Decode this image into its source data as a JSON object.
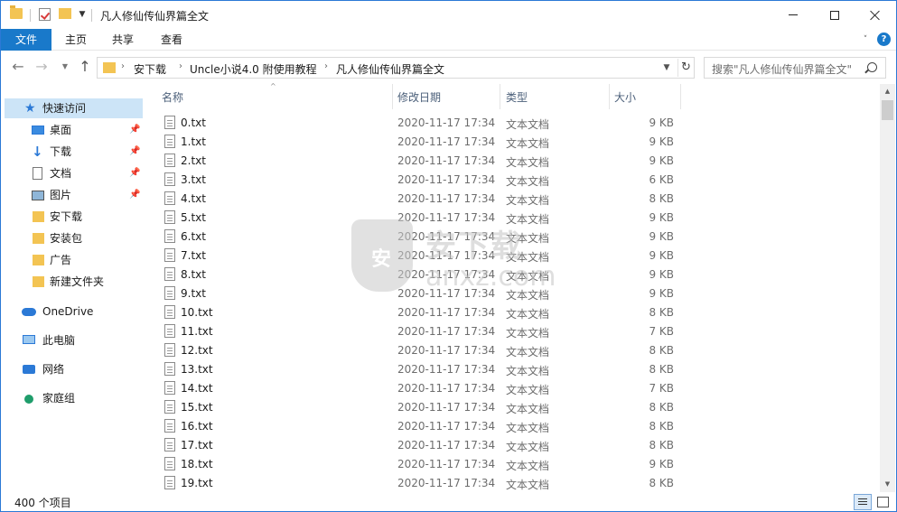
{
  "window": {
    "title": "凡人修仙传仙界篇全文"
  },
  "ribbon": {
    "tabs": [
      "文件",
      "主页",
      "共享",
      "查看"
    ]
  },
  "address": {
    "crumbs": [
      "安下载",
      "Uncle小说4.0 附使用教程",
      "凡人修仙传仙界篇全文"
    ]
  },
  "search": {
    "placeholder": "搜索\"凡人修仙传仙界篇全文\""
  },
  "sidebar": {
    "quick_access": "快速访问",
    "items": [
      {
        "label": "桌面",
        "icon": "desktop-icon",
        "pinned": true
      },
      {
        "label": "下载",
        "icon": "download-icon",
        "pinned": true
      },
      {
        "label": "文档",
        "icon": "document-icon",
        "pinned": true
      },
      {
        "label": "图片",
        "icon": "picture-icon",
        "pinned": true
      },
      {
        "label": "安下载",
        "icon": "folder-icon",
        "pinned": false
      },
      {
        "label": "安装包",
        "icon": "folder-icon",
        "pinned": false
      },
      {
        "label": "广告",
        "icon": "folder-icon",
        "pinned": false
      },
      {
        "label": "新建文件夹",
        "icon": "folder-icon",
        "pinned": false
      }
    ],
    "onedrive": "OneDrive",
    "this_pc": "此电脑",
    "network": "网络",
    "homegroup": "家庭组"
  },
  "columns": {
    "name": "名称",
    "date": "修改日期",
    "type": "类型",
    "size": "大小"
  },
  "files": [
    {
      "name": "0.txt",
      "date": "2020-11-17 17:34",
      "type": "文本文档",
      "size": "9 KB"
    },
    {
      "name": "1.txt",
      "date": "2020-11-17 17:34",
      "type": "文本文档",
      "size": "9 KB"
    },
    {
      "name": "2.txt",
      "date": "2020-11-17 17:34",
      "type": "文本文档",
      "size": "9 KB"
    },
    {
      "name": "3.txt",
      "date": "2020-11-17 17:34",
      "type": "文本文档",
      "size": "6 KB"
    },
    {
      "name": "4.txt",
      "date": "2020-11-17 17:34",
      "type": "文本文档",
      "size": "8 KB"
    },
    {
      "name": "5.txt",
      "date": "2020-11-17 17:34",
      "type": "文本文档",
      "size": "9 KB"
    },
    {
      "name": "6.txt",
      "date": "2020-11-17 17:34",
      "type": "文本文档",
      "size": "9 KB"
    },
    {
      "name": "7.txt",
      "date": "2020-11-17 17:34",
      "type": "文本文档",
      "size": "9 KB"
    },
    {
      "name": "8.txt",
      "date": "2020-11-17 17:34",
      "type": "文本文档",
      "size": "9 KB"
    },
    {
      "name": "9.txt",
      "date": "2020-11-17 17:34",
      "type": "文本文档",
      "size": "9 KB"
    },
    {
      "name": "10.txt",
      "date": "2020-11-17 17:34",
      "type": "文本文档",
      "size": "8 KB"
    },
    {
      "name": "11.txt",
      "date": "2020-11-17 17:34",
      "type": "文本文档",
      "size": "7 KB"
    },
    {
      "name": "12.txt",
      "date": "2020-11-17 17:34",
      "type": "文本文档",
      "size": "8 KB"
    },
    {
      "name": "13.txt",
      "date": "2020-11-17 17:34",
      "type": "文本文档",
      "size": "8 KB"
    },
    {
      "name": "14.txt",
      "date": "2020-11-17 17:34",
      "type": "文本文档",
      "size": "7 KB"
    },
    {
      "name": "15.txt",
      "date": "2020-11-17 17:34",
      "type": "文本文档",
      "size": "8 KB"
    },
    {
      "name": "16.txt",
      "date": "2020-11-17 17:34",
      "type": "文本文档",
      "size": "8 KB"
    },
    {
      "name": "17.txt",
      "date": "2020-11-17 17:34",
      "type": "文本文档",
      "size": "8 KB"
    },
    {
      "name": "18.txt",
      "date": "2020-11-17 17:34",
      "type": "文本文档",
      "size": "9 KB"
    },
    {
      "name": "19.txt",
      "date": "2020-11-17 17:34",
      "type": "文本文档",
      "size": "8 KB"
    }
  ],
  "status": {
    "count": "400 个项目"
  },
  "watermark": {
    "cn": "安下载",
    "en": "anxz.com",
    "badge": "安"
  },
  "colors": {
    "accent": "#1979ca",
    "selected": "#cce4f7",
    "folder": "#f3c453"
  }
}
